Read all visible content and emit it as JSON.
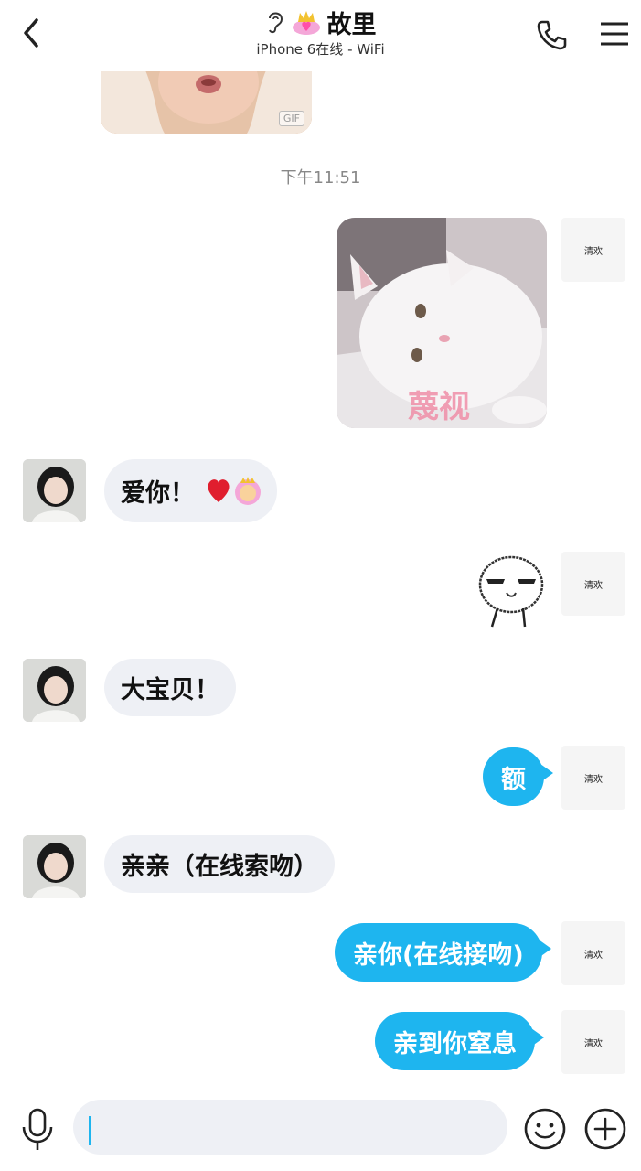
{
  "header": {
    "title": "故里",
    "subtitle": "iPhone 6在线 - WiFi"
  },
  "previous_gif_badge": "GIF",
  "timestamp": "下午11:51",
  "cat_image_caption": "蔑视",
  "my_avatar_text": "清欢",
  "messages": [
    {
      "side": "right",
      "type": "image",
      "content": "cat-sticker"
    },
    {
      "side": "left",
      "type": "text",
      "text": "爱你！"
    },
    {
      "side": "right",
      "type": "sticker",
      "content": "meme-face"
    },
    {
      "side": "left",
      "type": "text",
      "text": "大宝贝！"
    },
    {
      "side": "right",
      "type": "text",
      "text": "额"
    },
    {
      "side": "left",
      "type": "text",
      "text": "亲亲（在线索吻）"
    },
    {
      "side": "right",
      "type": "text",
      "text": "亲你(在线接吻)"
    },
    {
      "side": "right",
      "type": "text",
      "text": "亲到你窒息"
    }
  ],
  "input": {
    "value": "",
    "placeholder": ""
  },
  "colors": {
    "accent": "#1eb5ef",
    "bubble_left": "#eef0f5"
  },
  "icons": [
    "back-arrow-icon",
    "ear-icon",
    "crown-heart-icon",
    "phone-icon",
    "menu-icon",
    "microphone-icon",
    "smile-icon",
    "plus-icon"
  ]
}
